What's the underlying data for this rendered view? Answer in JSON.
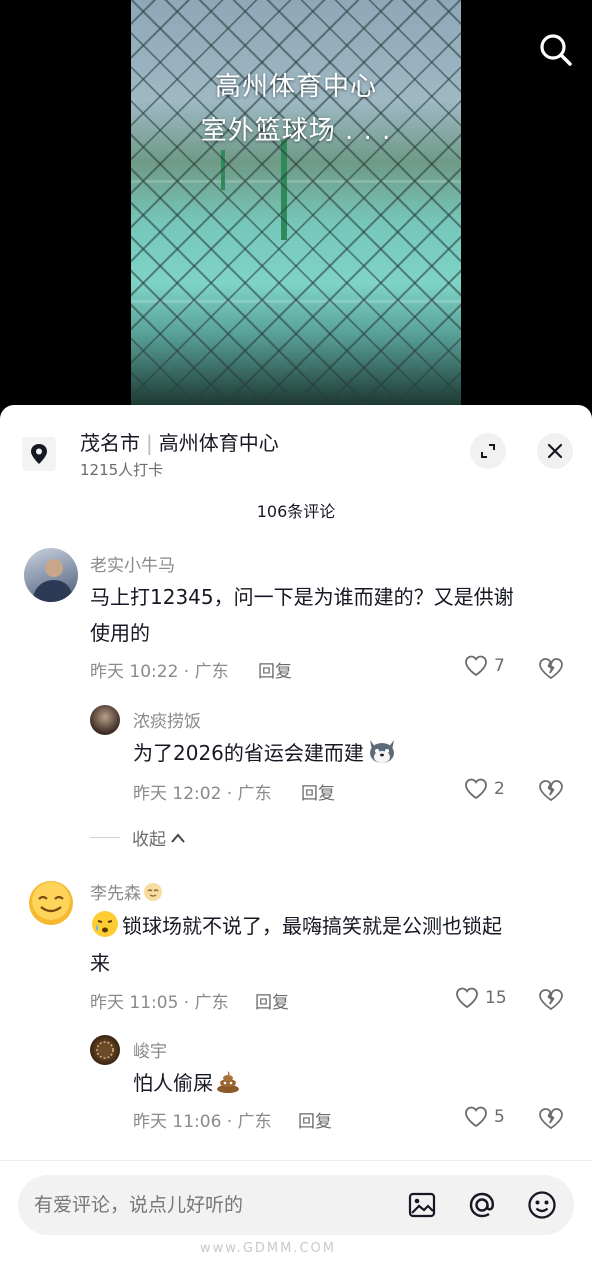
{
  "video": {
    "overlay_line1": "高州体育中心",
    "overlay_line2": "室外篮球场 . . ."
  },
  "location": {
    "city": "茂名市",
    "place": "高州体育中心",
    "checkins": "1215人打卡"
  },
  "comments_header": "106条评论",
  "comments": [
    {
      "user": "老实小牛马",
      "text_line1": "马上打12345，问一下是为谁而建的？又是供谢",
      "text_line2": "使用的",
      "meta": "昨天 10:22 · 广东",
      "reply_label": "回复",
      "likes": "7",
      "replies": [
        {
          "user": "浓痰捞饭",
          "text": "为了2026的省运会建而建",
          "meta": "昨天 12:02 · 广东",
          "reply_label": "回复",
          "likes": "2"
        }
      ],
      "collapse_label": "收起"
    },
    {
      "user": "李先森",
      "text_line1": "锁球场就不说了，最嗨搞笑就是公测也锁起",
      "text_line2": "来",
      "meta": "昨天 11:05 · 广东",
      "reply_label": "回复",
      "likes": "15",
      "replies": [
        {
          "user": "峻宇",
          "text": "怕人偷屎",
          "meta": "昨天 11:06 · 广东",
          "reply_label": "回复",
          "likes": "5"
        }
      ]
    }
  ],
  "input": {
    "placeholder": "有爱评论，说点儿好听的"
  },
  "watermark": "www.GDMM.COM",
  "colors": {
    "text_primary": "#161823",
    "text_secondary": "#8a8a8a",
    "sheet_bg": "#ffffff",
    "input_bg": "#f2f2f3"
  }
}
